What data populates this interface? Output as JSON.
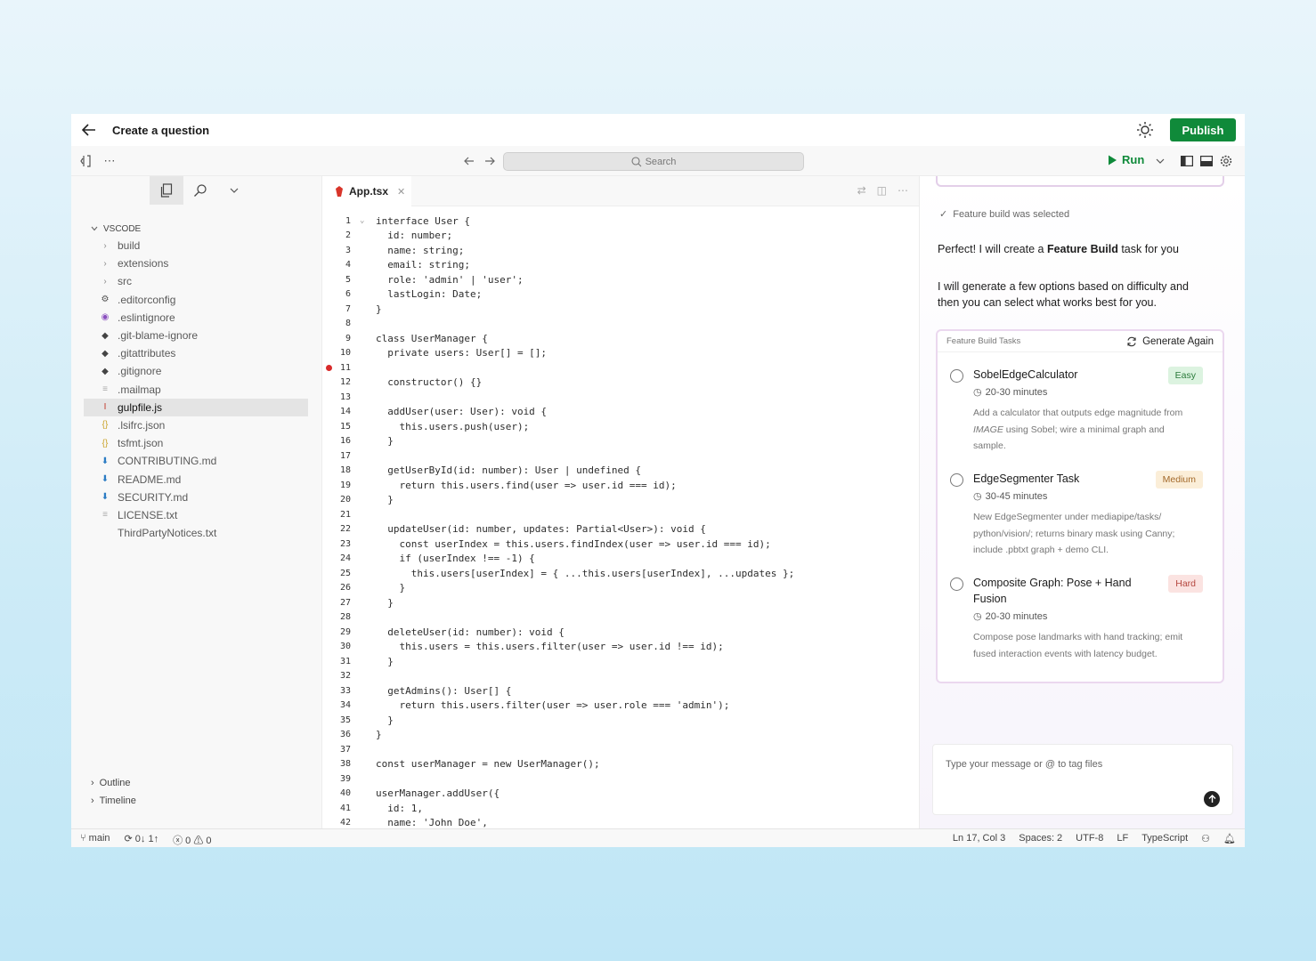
{
  "header": {
    "title": "Create a question",
    "publish_label": "Publish"
  },
  "toolbar": {
    "search_placeholder": "Search",
    "run_label": "Run"
  },
  "explorer": {
    "root_label": "VSCODE",
    "items": [
      {
        "label": "build",
        "type": "folder"
      },
      {
        "label": "extensions",
        "type": "folder"
      },
      {
        "label": "src",
        "type": "folder"
      },
      {
        "label": ".editorconfig",
        "type": "gear"
      },
      {
        "label": ".eslintignore",
        "type": "eslint"
      },
      {
        "label": ".git-blame-ignore",
        "type": "git"
      },
      {
        "label": ".gitattributes",
        "type": "git"
      },
      {
        "label": ".gitignore",
        "type": "git"
      },
      {
        "label": ".mailmap",
        "type": "text"
      },
      {
        "label": "gulpfile.js",
        "type": "gulp"
      },
      {
        "label": ".lsifrc.json",
        "type": "json"
      },
      {
        "label": "tsfmt.json",
        "type": "json"
      },
      {
        "label": "CONTRIBUTING.md",
        "type": "md"
      },
      {
        "label": "README.md",
        "type": "md"
      },
      {
        "label": "SECURITY.md",
        "type": "md"
      },
      {
        "label": "LICENSE.txt",
        "type": "text"
      },
      {
        "label": "ThirdPartyNotices.txt",
        "type": "none"
      }
    ],
    "selected": "gulpfile.js",
    "outline_label": "Outline",
    "timeline_label": "Timeline"
  },
  "editor": {
    "tab_label": "App.tsx",
    "breakpoint_line": 11,
    "lines": [
      "interface User {",
      "  id: number;",
      "  name: string;",
      "  email: string;",
      "  role: 'admin' | 'user';",
      "  lastLogin: Date;",
      "}",
      "",
      "class UserManager {",
      "  private users: User[] = [];",
      "",
      "  constructor() {}",
      "",
      "  addUser(user: User): void {",
      "    this.users.push(user);",
      "  }",
      "",
      "  getUserById(id: number): User | undefined {",
      "    return this.users.find(user => user.id === id);",
      "  }",
      "",
      "  updateUser(id: number, updates: Partial<User>): void {",
      "    const userIndex = this.users.findIndex(user => user.id === id);",
      "    if (userIndex !== -1) {",
      "      this.users[userIndex] = { ...this.users[userIndex], ...updates };",
      "    }",
      "  }",
      "",
      "  deleteUser(id: number): void {",
      "    this.users = this.users.filter(user => user.id !== id);",
      "  }",
      "",
      "  getAdmins(): User[] {",
      "    return this.users.filter(user => user.role === 'admin');",
      "  }",
      "}",
      "",
      "const userManager = new UserManager();",
      "",
      "userManager.addUser({",
      "  id: 1,",
      "  name: 'John Doe',"
    ]
  },
  "assistant": {
    "selected_note": "Feature build was selected",
    "msg1_pre": "Perfect! I will create a ",
    "msg1_bold": "Feature Build",
    "msg1_post": " task for you",
    "msg2": "I will generate a few options based on difficulty and then you can select what works best for you.",
    "tasks_title": "Feature Build Tasks",
    "generate_again": "Generate Again",
    "tasks": [
      {
        "name": "SobelEdgeCalculator",
        "time": "20-30 minutes",
        "desc_pre": "Add a calculator that outputs edge magnitude from ",
        "desc_em": "IMAGE",
        "desc_post": " using Sobel; wire a minimal graph and sample.",
        "badge": "Easy",
        "badge_color": "#dcf3e0",
        "badge_text_color": "#2a7a3a"
      },
      {
        "name": "EdgeSegmenter Task",
        "time": "30-45 minutes",
        "desc_pre": "New EdgeSegmenter under mediapipe/tasks/ python/vision/; returns binary mask using Canny; include .pbtxt graph + demo CLI.",
        "desc_em": "",
        "desc_post": "",
        "badge": "Medium",
        "badge_color": "#fbeed8",
        "badge_text_color": "#a3692a"
      },
      {
        "name": "Composite Graph: Pose + Hand Fusion",
        "time": "20-30 minutes",
        "desc_pre": "Compose pose landmarks with hand tracking; emit fused interaction events with latency budget.",
        "desc_em": "",
        "desc_post": "",
        "badge": "Hard",
        "badge_color": "#fbe3e1",
        "badge_text_color": "#b5473f"
      }
    ],
    "input_placeholder": "Type your message or @ to tag files"
  },
  "statusbar": {
    "branch": "main",
    "sync": "0↓ 1↑",
    "problems": "0 ⚠ 0",
    "position": "Ln 17, Col 3",
    "spaces": "Spaces: 2",
    "encoding": "UTF-8",
    "eol": "LF",
    "language": "TypeScript"
  }
}
